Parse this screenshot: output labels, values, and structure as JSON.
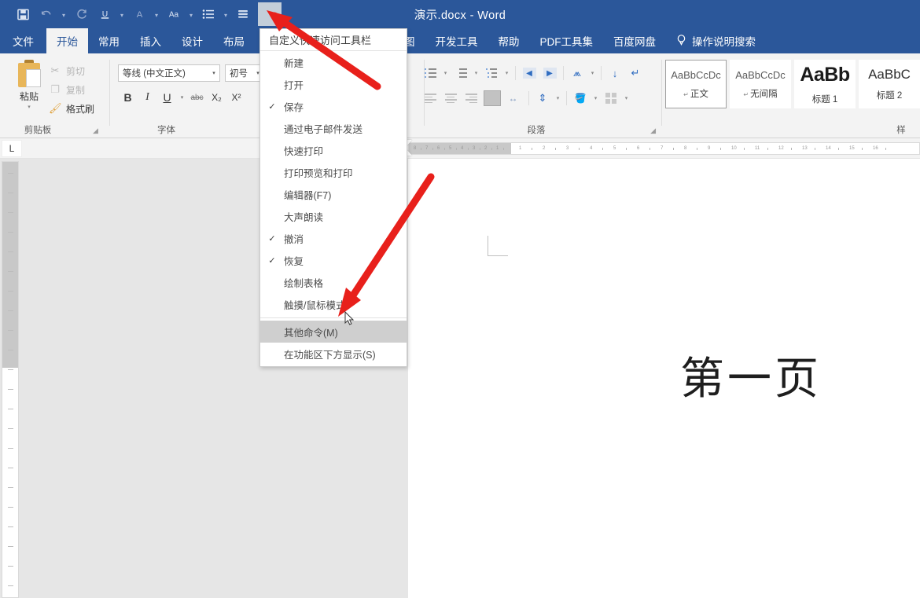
{
  "window": {
    "title": "演示.docx  -  Word"
  },
  "quick_access": {
    "items": [
      {
        "name": "save-icon",
        "glyph": "▤"
      },
      {
        "name": "undo-icon",
        "glyph": "↶"
      },
      {
        "name": "redo-icon",
        "glyph": "↺"
      },
      {
        "name": "underline-icon",
        "glyph": "U"
      },
      {
        "name": "font-color-icon",
        "glyph": "A"
      },
      {
        "name": "change-case-icon",
        "glyph": "Aa"
      },
      {
        "name": "bullet-list-icon",
        "glyph": "☰"
      },
      {
        "name": "line-spacing-icon",
        "glyph": "≡"
      }
    ],
    "more_button_label": "⬩"
  },
  "tabs": [
    {
      "label": "文件",
      "active": false,
      "kind": "file"
    },
    {
      "label": "开始",
      "active": true,
      "kind": "normal"
    },
    {
      "label": "常用",
      "active": false,
      "kind": "normal"
    },
    {
      "label": "插入",
      "active": false,
      "kind": "normal"
    },
    {
      "label": "设计",
      "active": false,
      "kind": "normal"
    },
    {
      "label": "布局",
      "active": false,
      "kind": "normal"
    },
    {
      "label": "图",
      "active": false,
      "kind": "normal"
    },
    {
      "label": "开发工具",
      "active": false,
      "kind": "normal"
    },
    {
      "label": "帮助",
      "active": false,
      "kind": "normal"
    },
    {
      "label": "PDF工具集",
      "active": false,
      "kind": "normal"
    },
    {
      "label": "百度网盘",
      "active": false,
      "kind": "normal"
    },
    {
      "label": "操作说明搜索",
      "active": false,
      "kind": "tell"
    }
  ],
  "ribbon": {
    "clipboard": {
      "group_label": "剪贴板",
      "paste_label": "粘贴",
      "cut_label": "剪切",
      "copy_label": "复制",
      "format_painter_label": "格式刷"
    },
    "font": {
      "group_label": "字体",
      "font_name": "等线 (中文正文)",
      "font_size": "初号",
      "bold": "B",
      "italic": "I",
      "underline": "U",
      "strikethrough": "abc",
      "subscript": "X₂",
      "superscript": "X²"
    },
    "paragraph": {
      "group_label": "段落"
    },
    "styles": {
      "group_label": "样",
      "items": [
        {
          "preview": "AaBbCcDc",
          "name": "正文",
          "selected": true,
          "size": "normal",
          "pilcrow": "↵"
        },
        {
          "preview": "AaBbCcDc",
          "name": "无间隔",
          "selected": false,
          "size": "normal",
          "pilcrow": "↵"
        },
        {
          "preview": "AaBb",
          "name": "标题 1",
          "selected": false,
          "size": "big",
          "pilcrow": ""
        },
        {
          "preview": "AaBbC",
          "name": "标题 2",
          "selected": false,
          "size": "med",
          "pilcrow": ""
        }
      ]
    }
  },
  "menu": {
    "header": "自定义快速访问工具栏",
    "items": [
      {
        "label": "新建",
        "checked": false,
        "highlighted": false
      },
      {
        "label": "打开",
        "checked": false,
        "highlighted": false
      },
      {
        "label": "保存",
        "checked": true,
        "highlighted": false
      },
      {
        "label": "通过电子邮件发送",
        "checked": false,
        "highlighted": false
      },
      {
        "label": "快速打印",
        "checked": false,
        "highlighted": false
      },
      {
        "label": "打印预览和打印",
        "checked": false,
        "highlighted": false
      },
      {
        "label": "编辑器(F7)",
        "checked": false,
        "highlighted": false
      },
      {
        "label": "大声朗读",
        "checked": false,
        "highlighted": false
      },
      {
        "label": "撤消",
        "checked": true,
        "highlighted": false
      },
      {
        "label": "恢复",
        "checked": true,
        "highlighted": false
      },
      {
        "label": "绘制表格",
        "checked": false,
        "highlighted": false
      },
      {
        "label": "触摸/鼠标模式",
        "checked": false,
        "highlighted": false
      },
      {
        "label": "其他命令(M)",
        "checked": false,
        "highlighted": true
      },
      {
        "label": "在功能区下方显示(S)",
        "checked": false,
        "highlighted": false
      }
    ]
  },
  "ruler": {
    "corner_tab": "L",
    "left_ticks": [
      "8",
      "7",
      "6",
      "5",
      "4",
      "3",
      "2",
      "1"
    ],
    "right_ticks": [
      "1",
      "2",
      "3",
      "4",
      "5",
      "6",
      "7",
      "8",
      "9",
      "10",
      "11",
      "12",
      "13",
      "14",
      "15",
      "16"
    ]
  },
  "document": {
    "page_text": "第一页"
  },
  "colors": {
    "word_blue": "#2b579a",
    "ribbon_bg": "#f3f3f3",
    "doc_bg": "#e6e6e6",
    "arrow_red": "#e8201b",
    "menu_highlight": "#cfcfcf",
    "accent_orange": "#e8b65a"
  }
}
